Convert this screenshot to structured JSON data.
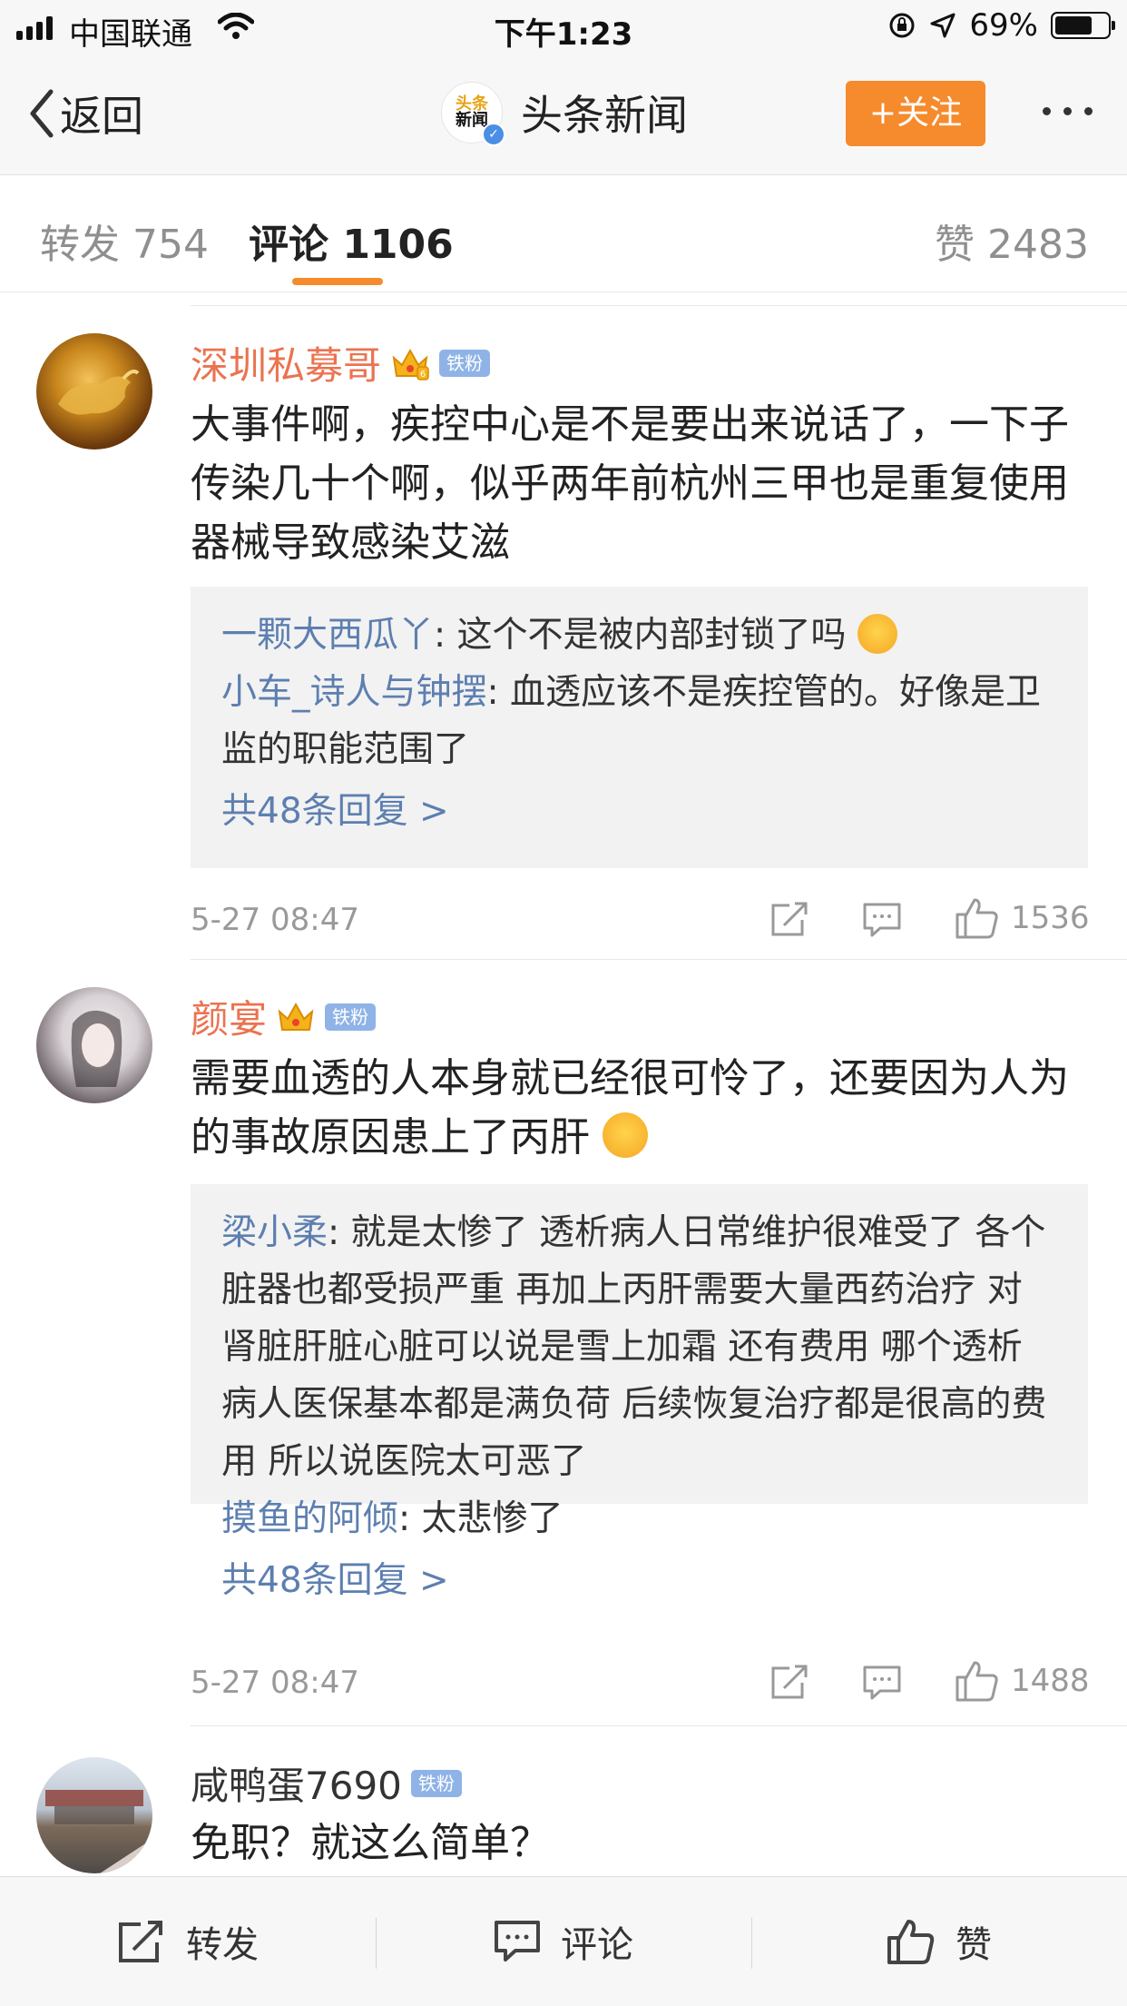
{
  "status_bar": {
    "carrier": "中国联通",
    "time": "下午1:23",
    "battery_pct": "69%"
  },
  "nav": {
    "back_label": "返回",
    "account_logo_line1": "头条",
    "account_logo_line2": "新闻",
    "title": "头条新闻",
    "follow_label": "+关注"
  },
  "tabs": {
    "repost": "转发 754",
    "comments": "评论 1106",
    "likes": "赞 2483"
  },
  "comments": [
    {
      "username": "深圳私募哥",
      "crown_level": "6",
      "badge": "铁粉",
      "text": "大事件啊，疾控中心是不是要出来说话了，一下子传染几十个啊，似乎两年前杭州三甲也是重复使用器械导致感染艾滋",
      "replies": [
        {
          "user": "一颗大西瓜丫",
          "text": ": 这个不是被内部封锁了吗"
        },
        {
          "user": "小车_诗人与钟摆",
          "text": ": 血透应该不是疾控管的。好像是卫监的职能范围了"
        }
      ],
      "more_replies": "共48条回复 >",
      "date": "5-27 08:47",
      "likes": "1536"
    },
    {
      "username": "颜宴",
      "badge": "铁粉",
      "text": "需要血透的人本身就已经很可怜了，还要因为人为的事故原因患上了丙肝",
      "replies": [
        {
          "user": "梁小柔",
          "text": ": 就是太惨了 透析病人日常维护很难受了 各个脏器也都受损严重 再加上丙肝需要大量西药治疗 对肾脏肝脏心脏可以说是雪上加霜 还有费用 哪个透析病人医保基本都是满负荷 后续恢复治疗都是很高的费用 所以说医院太可恶了"
        },
        {
          "user": "摸鱼的阿倾",
          "text": ": 太悲惨了"
        }
      ],
      "more_replies": "共48条回复 >",
      "date": "5-27 08:47",
      "likes": "1488"
    },
    {
      "username": "咸鸭蛋7690",
      "badge": "铁粉",
      "text": "免职？就这么简单？"
    }
  ],
  "bottom_bar": {
    "repost": "转发",
    "comment": "评论",
    "like": "赞"
  },
  "colors": {
    "accent_orange": "#f58b2c",
    "username_orange": "#eb7350",
    "link_blue": "#5d7fb0",
    "badge_blue": "#8fb3e6"
  }
}
